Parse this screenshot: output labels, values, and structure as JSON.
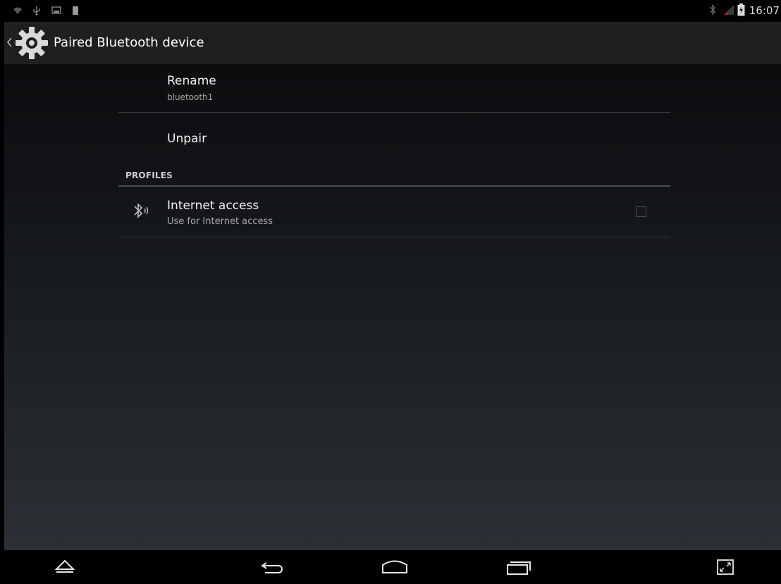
{
  "status_bar": {
    "time": "16:07",
    "left_icons": [
      "wifi-icon",
      "usb-icon",
      "screenshot-icon",
      "sim-icon"
    ],
    "right_icons": [
      "bluetooth-icon",
      "signal-icon",
      "battery-icon"
    ]
  },
  "action_bar": {
    "title": "Paired Bluetooth device",
    "icon": "settings-icon"
  },
  "preferences": {
    "rename": {
      "title": "Rename",
      "summary": "bluetooth1"
    },
    "unpair": {
      "title": "Unpair"
    },
    "profiles_header": "PROFILES",
    "internet_access": {
      "title": "Internet access",
      "summary": "Use for Internet access",
      "checked": false,
      "icon": "bluetooth-network-icon"
    }
  },
  "nav_bar": {
    "buttons": [
      "hide-keyboard-icon",
      "back-icon",
      "home-icon",
      "recents-icon",
      "fullscreen-icon"
    ]
  }
}
